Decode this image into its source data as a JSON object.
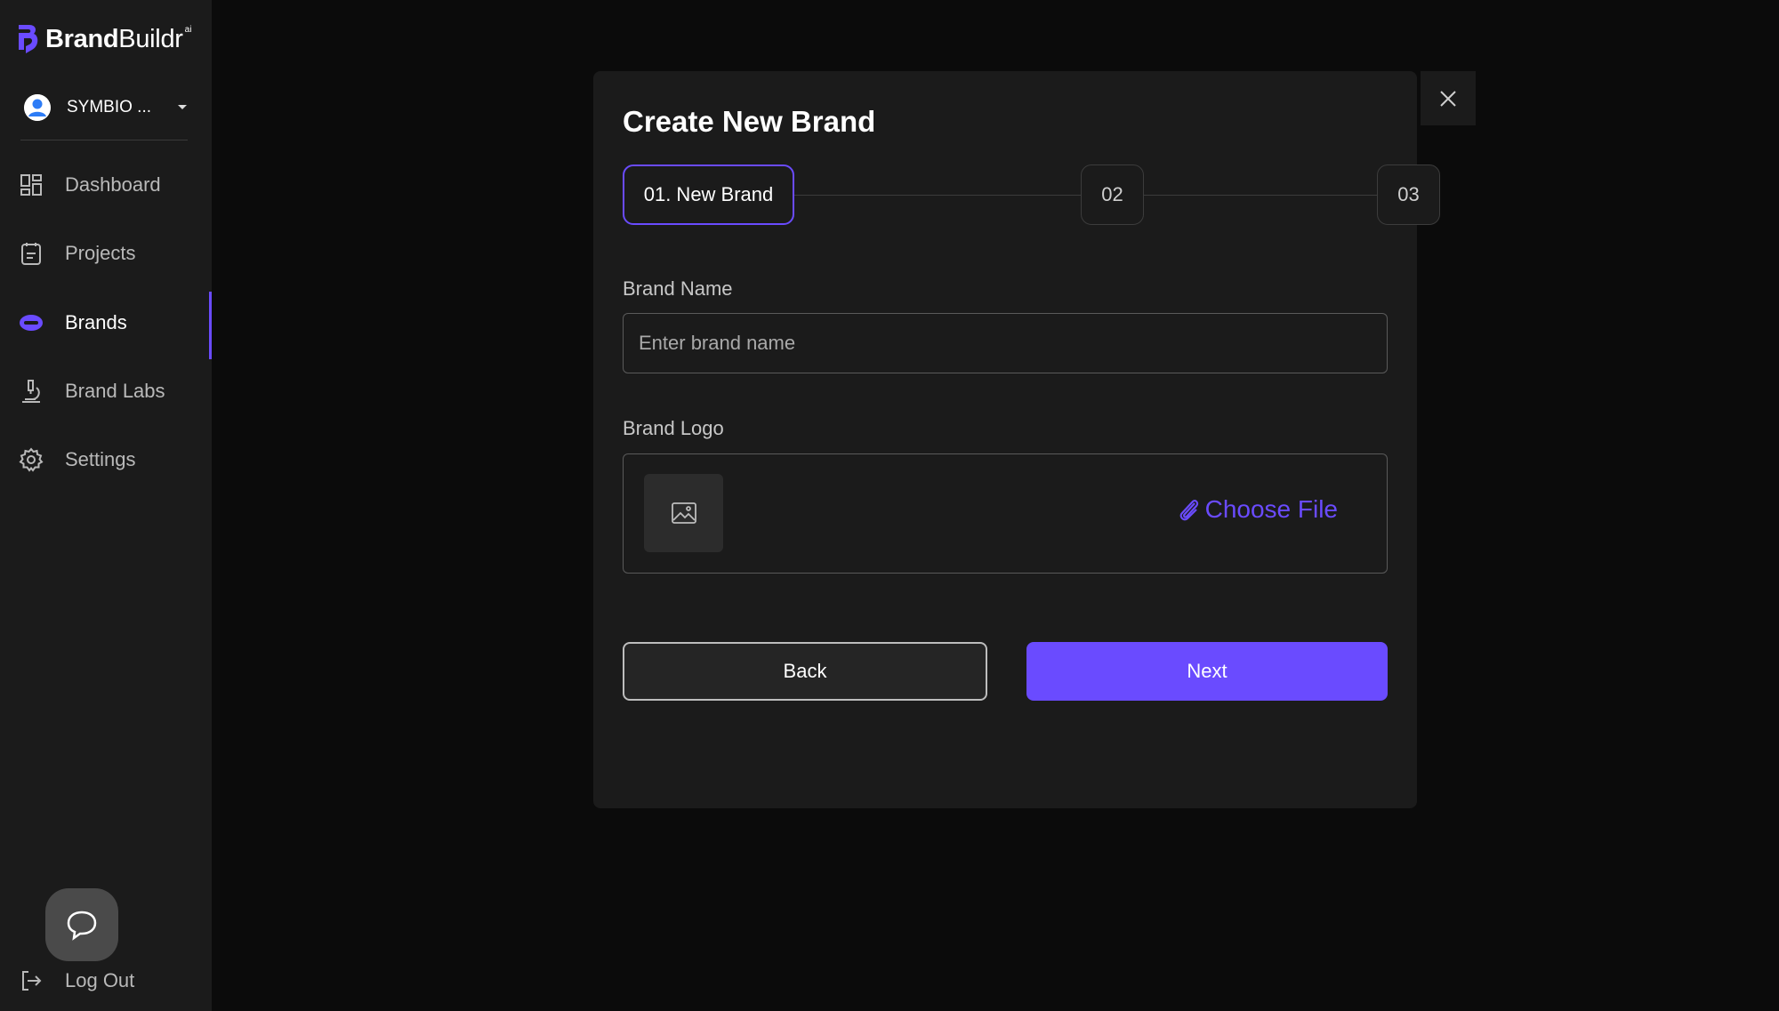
{
  "brand": {
    "name_bold": "Brand",
    "name_light": "Buildr",
    "superscript": "ai",
    "accent": "#6a4bff"
  },
  "account": {
    "name": "SYMBIO ..."
  },
  "sidebar": {
    "items": [
      {
        "label": "Dashboard",
        "icon": "dashboard-icon",
        "active": false
      },
      {
        "label": "Projects",
        "icon": "projects-icon",
        "active": false
      },
      {
        "label": "Brands",
        "icon": "brands-icon",
        "active": true
      },
      {
        "label": "Brand Labs",
        "icon": "microscope-icon",
        "active": false
      },
      {
        "label": "Settings",
        "icon": "gear-icon",
        "active": false
      }
    ],
    "logout_label": "Log Out"
  },
  "modal": {
    "title": "Create New Brand",
    "steps": [
      {
        "label": "01. New Brand",
        "active": true
      },
      {
        "label": "02",
        "active": false
      },
      {
        "label": "03",
        "active": false
      }
    ],
    "brand_name": {
      "label": "Brand Name",
      "value": "",
      "placeholder": "Enter brand name"
    },
    "brand_logo": {
      "label": "Brand Logo",
      "choose_label": "Choose File"
    },
    "back_label": "Back",
    "next_label": "Next"
  }
}
